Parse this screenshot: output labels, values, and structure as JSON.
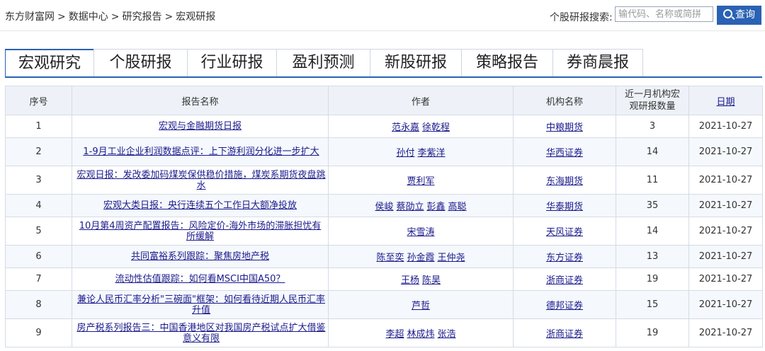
{
  "breadcrumb": [
    "东方财富网",
    "数据中心",
    "研究报告",
    "宏观研报"
  ],
  "search": {
    "label": "个股研报搜索:",
    "placeholder": "输代码、名称或简拼",
    "button": "查询"
  },
  "tabs": [
    "宏观研究",
    "个股研报",
    "行业研报",
    "盈利预测",
    "新股研报",
    "策略报告",
    "券商晨报"
  ],
  "table": {
    "headers": {
      "no": "序号",
      "title": "报告名称",
      "author": "作者",
      "org": "机构名称",
      "count": "近一月机构宏观研报数量",
      "date": "日期"
    },
    "rows": [
      {
        "no": "1",
        "title": "宏观与金融期货日报",
        "authors": [
          "范永嘉",
          "徐乾程"
        ],
        "org": "中粮期货",
        "count": "3",
        "date": "2021-10-27"
      },
      {
        "no": "2",
        "title": "1-9月工业企业利润数据点评：上下游利润分化进一步扩大",
        "authors": [
          "孙付",
          "李紫洋"
        ],
        "org": "华西证券",
        "count": "14",
        "date": "2021-10-27"
      },
      {
        "no": "3",
        "title": "宏观日报：发改委加码煤炭保供稳价措施，煤炭系期货夜盘跳水",
        "authors": [
          "贾利军"
        ],
        "org": "东海期货",
        "count": "11",
        "date": "2021-10-27"
      },
      {
        "no": "4",
        "title": "宏观大类日报：央行连续五个工作日大额净投放",
        "authors": [
          "侯峻",
          "蔡劭立",
          "彭鑫",
          "高聪"
        ],
        "org": "华泰期货",
        "count": "35",
        "date": "2021-10-27"
      },
      {
        "no": "5",
        "title": "10月第4周资产配置报告：风险定价-海外市场的滞胀担忧有所缓解",
        "authors": [
          "宋雪涛"
        ],
        "org": "天风证券",
        "count": "14",
        "date": "2021-10-27"
      },
      {
        "no": "6",
        "title": "共同富裕系列跟踪：聚焦房地产税",
        "authors": [
          "陈至奕",
          "孙金霞",
          "王仲尧"
        ],
        "org": "东方证券",
        "count": "13",
        "date": "2021-10-27"
      },
      {
        "no": "7",
        "title": "流动性估值跟踪：如何看MSCI中国A50？",
        "authors": [
          "王杨",
          "陈昊"
        ],
        "org": "浙商证券",
        "count": "19",
        "date": "2021-10-27"
      },
      {
        "no": "8",
        "title": "兼论人民币汇率分析\"三碗面\"框架：如何看待近期人民币汇率升值",
        "authors": [
          "芦哲"
        ],
        "org": "德邦证券",
        "count": "15",
        "date": "2021-10-27"
      },
      {
        "no": "9",
        "title": "房产税系列报告三：中国香港地区对我国房产税试点扩大借鉴意义有限",
        "authors": [
          "李超",
          "林成炜",
          "张浩"
        ],
        "org": "浙商证券",
        "count": "19",
        "date": "2021-10-27"
      }
    ]
  },
  "colors": {
    "accent": "#2a62b4",
    "link": "#1a1a8c",
    "header_bg": "#eef2f8",
    "border": "#d5dbe5"
  }
}
